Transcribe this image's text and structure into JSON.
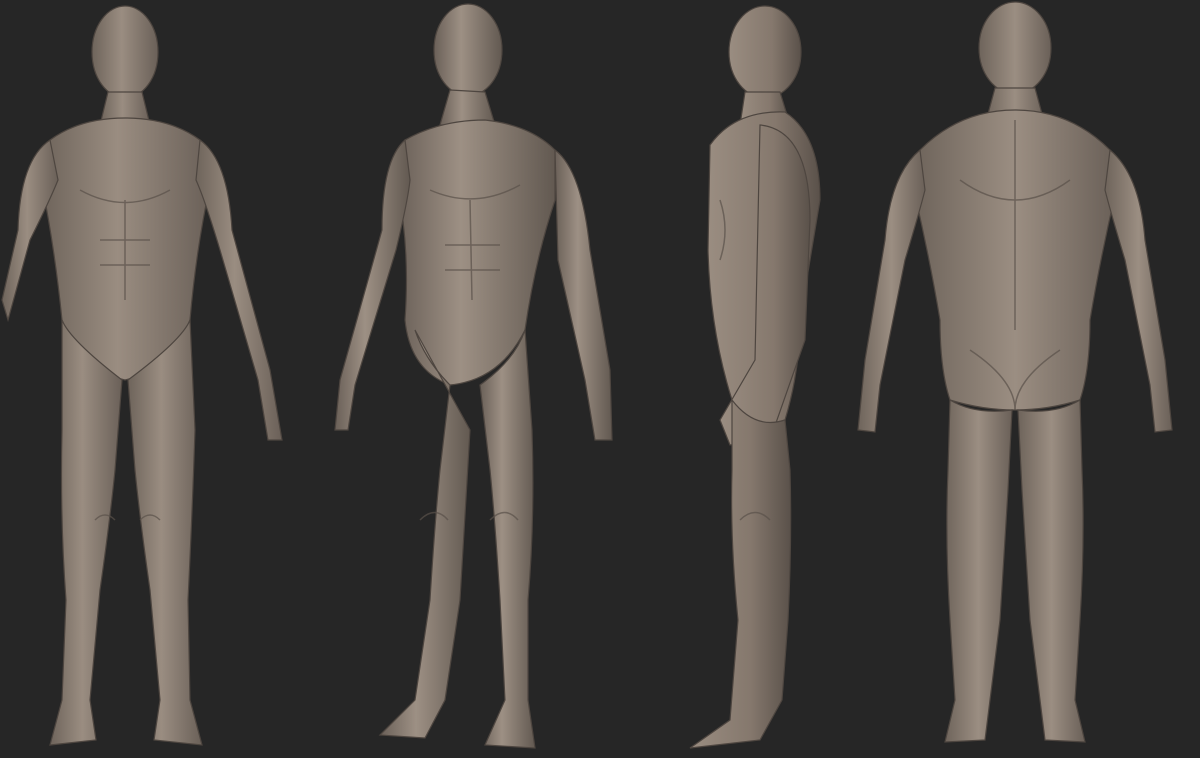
{
  "render": {
    "background_color": "#262626",
    "clay_color": "#8a7d72",
    "clay_shadow_color": "#5e544c",
    "clay_highlight_color": "#a89a8e"
  },
  "views": [
    {
      "name": "front",
      "icon": "figure-front"
    },
    {
      "name": "three-quarter",
      "icon": "figure-three-quarter"
    },
    {
      "name": "side",
      "icon": "figure-side"
    },
    {
      "name": "back",
      "icon": "figure-back"
    }
  ]
}
